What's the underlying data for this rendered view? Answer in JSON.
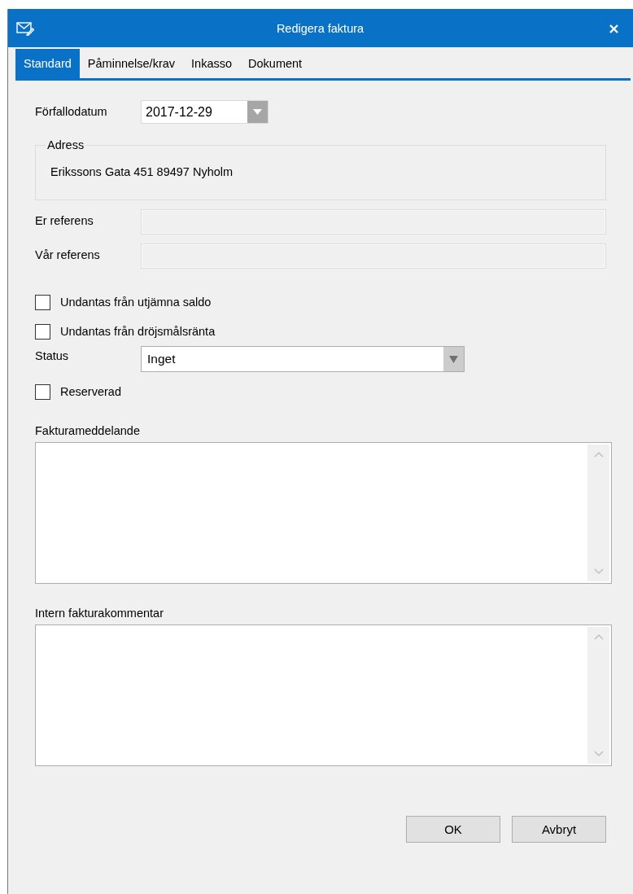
{
  "window": {
    "title": "Redigera faktura"
  },
  "tabs": [
    {
      "label": "Standard",
      "selected": true
    },
    {
      "label": "Påminnelse/krav",
      "selected": false
    },
    {
      "label": "Inkasso",
      "selected": false
    },
    {
      "label": "Dokument",
      "selected": false
    }
  ],
  "due_date": {
    "label": "Förfallodatum",
    "value": "2017-12-29"
  },
  "address": {
    "legend": "Adress",
    "text": "Erikssons Gata 451 89497 Nyholm"
  },
  "references": [
    {
      "label": "Er referens",
      "disabled": true
    },
    {
      "label": "Vår referens",
      "disabled": true
    }
  ],
  "exemptions": [
    {
      "label": "Undantas från utjämna saldo",
      "checked": false
    },
    {
      "label": "Undantas från dröjsmålsränta",
      "checked": false
    }
  ],
  "status": {
    "label": "Status",
    "value": "Inget"
  },
  "reserved": {
    "label": "Reserverad",
    "checked": false
  },
  "text_areas": [
    {
      "label": "Fakturameddelande"
    },
    {
      "label": "Intern fakturakommentar"
    }
  ],
  "buttons": [
    "OK",
    "Avbryt"
  ]
}
